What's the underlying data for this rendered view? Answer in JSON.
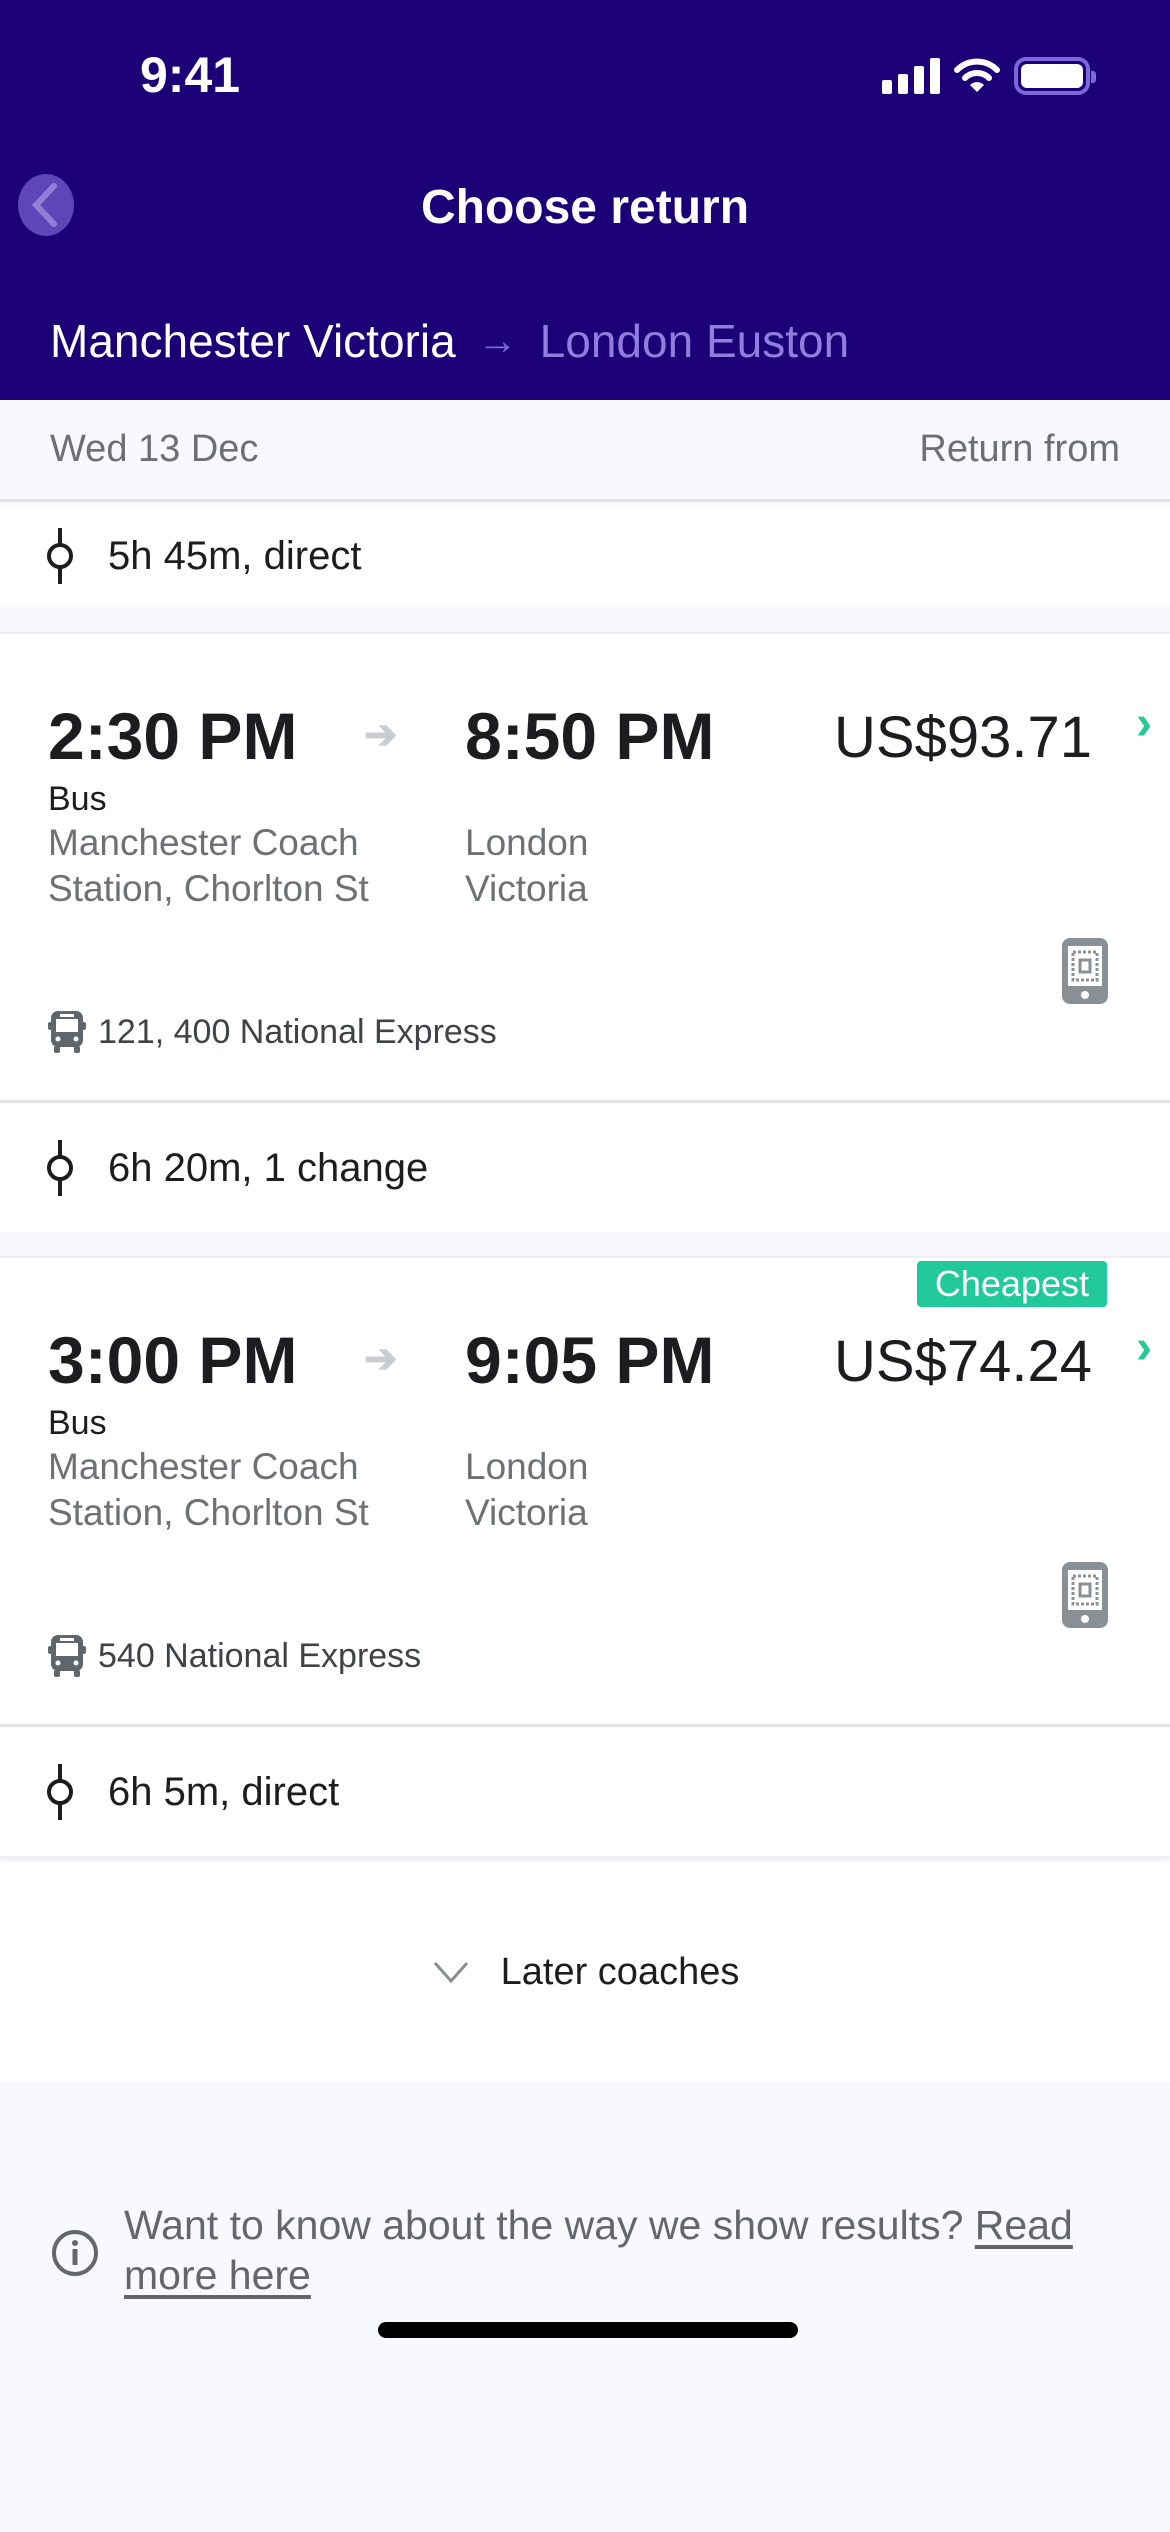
{
  "status_bar": {
    "time": "9:41",
    "icons": [
      "cellular-signal-icon",
      "wifi-icon",
      "battery-icon"
    ]
  },
  "header": {
    "back_icon": "chevron-left-icon",
    "title": "Choose return",
    "route": {
      "from": "Manchester Victoria",
      "arrow": "→",
      "to": "London Euston"
    }
  },
  "date_bar": {
    "date": "Wed 13 Dec",
    "label": "Return from"
  },
  "colors": {
    "header_bg": "#1b0078",
    "accent": "#21c99b"
  },
  "previous_result": {
    "duration": "5h 45m, direct"
  },
  "results": [
    {
      "depart_time": "2:30 PM",
      "arrive_time": "8:50 PM",
      "mode": "Bus",
      "from_station_line1": "Manchester Coach",
      "from_station_line2": "Station, Chorlton St",
      "to_station_line1": "London",
      "to_station_line2": "Victoria",
      "price": "US$93.71",
      "badge": "",
      "ticket_icon": "mobile-ticket-icon",
      "operator": "121, 400 National Express",
      "duration": "6h 20m, 1 change"
    },
    {
      "depart_time": "3:00 PM",
      "arrive_time": "9:05 PM",
      "mode": "Bus",
      "from_station_line1": "Manchester Coach",
      "from_station_line2": "Station, Chorlton St",
      "to_station_line1": "London",
      "to_station_line2": "Victoria",
      "price": "US$74.24",
      "badge": "Cheapest",
      "ticket_icon": "mobile-ticket-icon",
      "operator": "540 National Express",
      "duration": "6h 5m, direct"
    }
  ],
  "later_coaches": {
    "label": "Later coaches"
  },
  "info": {
    "text": "Want to know about the way we show results? ",
    "link": "Read more here"
  },
  "arrow_glyph": "➔",
  "chevron_glyph": "›"
}
